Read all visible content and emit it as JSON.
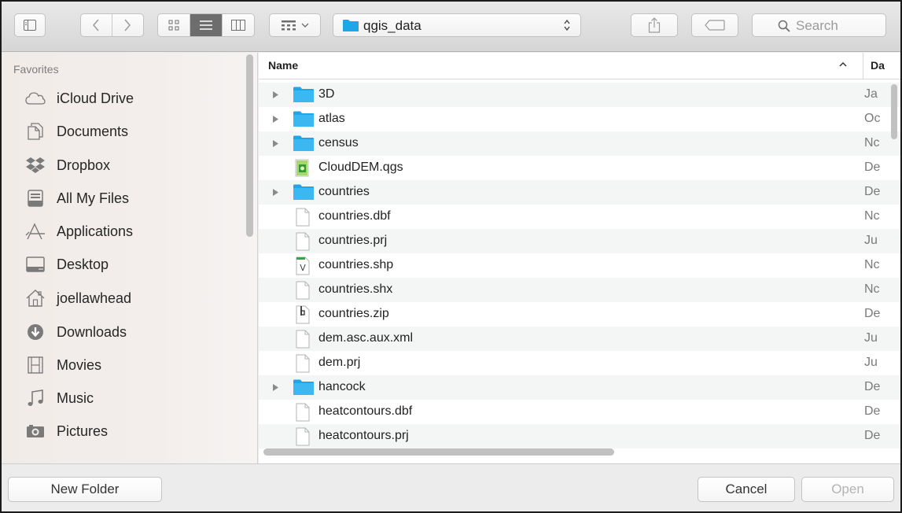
{
  "toolbar": {
    "path_label": "qgis_data",
    "search_placeholder": "Search"
  },
  "sidebar": {
    "heading": "Favorites",
    "items": [
      {
        "label": "iCloud Drive",
        "icon": "cloud-icon"
      },
      {
        "label": "Documents",
        "icon": "documents-icon"
      },
      {
        "label": "Dropbox",
        "icon": "dropbox-icon"
      },
      {
        "label": "All My Files",
        "icon": "all-files-icon"
      },
      {
        "label": "Applications",
        "icon": "applications-icon"
      },
      {
        "label": "Desktop",
        "icon": "desktop-icon"
      },
      {
        "label": "joellawhead",
        "icon": "home-icon"
      },
      {
        "label": "Downloads",
        "icon": "downloads-icon"
      },
      {
        "label": "Movies",
        "icon": "movies-icon"
      },
      {
        "label": "Music",
        "icon": "music-icon"
      },
      {
        "label": "Pictures",
        "icon": "pictures-icon"
      }
    ]
  },
  "filelist": {
    "col_name": "Name",
    "col_date": "Da",
    "rows": [
      {
        "name": "3D",
        "date": "Ja",
        "kind": "folder"
      },
      {
        "name": "atlas",
        "date": "Oc",
        "kind": "folder"
      },
      {
        "name": "census",
        "date": "Nc",
        "kind": "folder"
      },
      {
        "name": "CloudDEM.qgs",
        "date": "De",
        "kind": "qgs"
      },
      {
        "name": "countries",
        "date": "De",
        "kind": "folder"
      },
      {
        "name": "countries.dbf",
        "date": "Nc",
        "kind": "doc"
      },
      {
        "name": "countries.prj",
        "date": "Ju",
        "kind": "doc"
      },
      {
        "name": "countries.shp",
        "date": "Nc",
        "kind": "shp"
      },
      {
        "name": "countries.shx",
        "date": "Nc",
        "kind": "doc"
      },
      {
        "name": "countries.zip",
        "date": "De",
        "kind": "zip"
      },
      {
        "name": "dem.asc.aux.xml",
        "date": "Ju",
        "kind": "doc"
      },
      {
        "name": "dem.prj",
        "date": "Ju",
        "kind": "doc"
      },
      {
        "name": "hancock",
        "date": "De",
        "kind": "folder"
      },
      {
        "name": "heatcontours.dbf",
        "date": "De",
        "kind": "doc"
      },
      {
        "name": "heatcontours.prj",
        "date": "De",
        "kind": "doc"
      }
    ]
  },
  "buttons": {
    "new_folder": "New Folder",
    "cancel": "Cancel",
    "open": "Open"
  }
}
